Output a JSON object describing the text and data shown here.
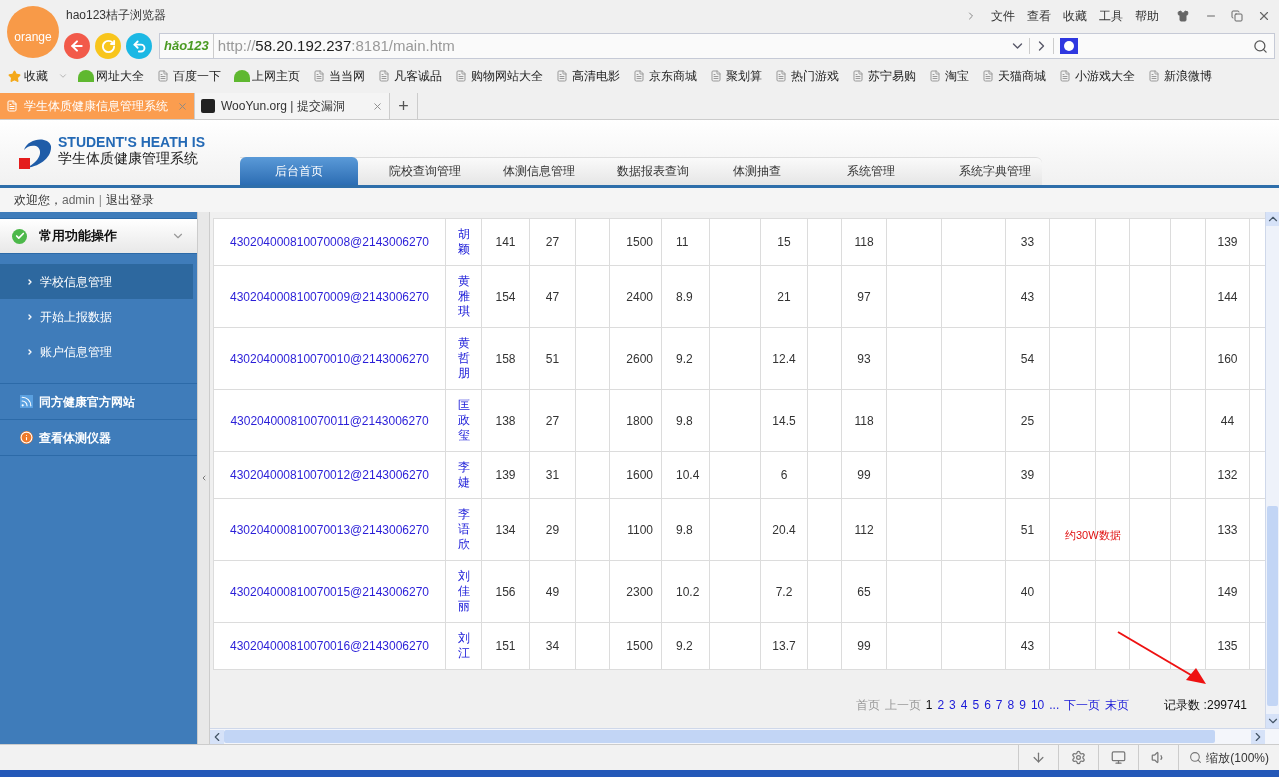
{
  "browser": {
    "logo": "orange",
    "title": "hao123桔子浏览器",
    "menu": [
      "文件",
      "查看",
      "收藏",
      "工具",
      "帮助"
    ],
    "address": {
      "badge": "hǎo123",
      "scheme": "http://",
      "host": "58.20.192.237",
      "rest": ":8181/main.htm"
    },
    "favorites_label": "收藏",
    "bookmarks": [
      {
        "label": "网址大全",
        "kind": "hao"
      },
      {
        "label": "百度一下",
        "kind": "page"
      },
      {
        "label": "上网主页",
        "kind": "hao"
      },
      {
        "label": "当当网",
        "kind": "page"
      },
      {
        "label": "凡客诚品",
        "kind": "page"
      },
      {
        "label": "购物网站大全",
        "kind": "page"
      },
      {
        "label": "高清电影",
        "kind": "page"
      },
      {
        "label": "京东商城",
        "kind": "page"
      },
      {
        "label": "聚划算",
        "kind": "page"
      },
      {
        "label": "热门游戏",
        "kind": "page"
      },
      {
        "label": "苏宁易购",
        "kind": "page"
      },
      {
        "label": "淘宝",
        "kind": "page"
      },
      {
        "label": "天猫商城",
        "kind": "page"
      },
      {
        "label": "小游戏大全",
        "kind": "page"
      },
      {
        "label": "新浪微博",
        "kind": "page"
      }
    ],
    "tabs": [
      {
        "label": "学生体质健康信息管理系统",
        "selected": true
      },
      {
        "label": "WooYun.org | 提交漏洞",
        "selected": false
      }
    ],
    "new_tab": "+"
  },
  "app": {
    "logo_en": "STUDENT'S HEATH IS",
    "logo_cn": "学生体质健康管理系统",
    "nav": [
      {
        "label": "后台首页",
        "selected": true
      },
      {
        "label": "院校查询管理",
        "selected": false
      },
      {
        "label": "体测信息管理",
        "selected": false
      },
      {
        "label": "数据报表查询",
        "selected": false
      },
      {
        "label": "体测抽查",
        "selected": false
      },
      {
        "label": "系统管理",
        "selected": false
      },
      {
        "label": "系统字典管理",
        "selected": false
      }
    ],
    "welcome": "欢迎您，",
    "user": "admin",
    "separator": "|",
    "logout": "退出登录"
  },
  "sidebar": {
    "group": {
      "label": "常用功能操作",
      "expanded": true,
      "items": [
        {
          "label": "学校信息管理",
          "selected": true
        },
        {
          "label": "开始上报数据",
          "selected": false
        },
        {
          "label": "账户信息管理",
          "selected": false
        }
      ]
    },
    "links": [
      {
        "label": "同方健康官方网站",
        "kind": "rss"
      },
      {
        "label": "查看体测仪器",
        "kind": "info"
      }
    ]
  },
  "table": {
    "rows": [
      {
        "id": "430204000810070008@2143006270",
        "name": "胡颖",
        "cells": {
          "column_3": "141",
          "column_4": "27",
          "column_6": "1500",
          "column_7": "11",
          "column_9": "15",
          "column_11": "118",
          "column_14": "33",
          "column_19": "139"
        }
      },
      {
        "id": "430204000810070009@2143006270",
        "name": "黄雅琪",
        "cells": {
          "column_3": "154",
          "column_4": "47",
          "column_6": "2400",
          "column_7": "8.9",
          "column_9": "21",
          "column_11": "97",
          "column_14": "43",
          "column_19": "144"
        }
      },
      {
        "id": "430204000810070010@2143006270",
        "name": "黄哲朋",
        "cells": {
          "column_3": "158",
          "column_4": "51",
          "column_6": "2600",
          "column_7": "9.2",
          "column_9": "12.4",
          "column_11": "93",
          "column_14": "54",
          "column_19": "160"
        }
      },
      {
        "id": "430204000810070011@2143006270",
        "name": "匡政玺",
        "cells": {
          "column_3": "138",
          "column_4": "27",
          "column_6": "1800",
          "column_7": "9.8",
          "column_9": "14.5",
          "column_11": "118",
          "column_14": "25",
          "column_19": "44"
        }
      },
      {
        "id": "430204000810070012@2143006270",
        "name": "李婕",
        "cells": {
          "column_3": "139",
          "column_4": "31",
          "column_6": "1600",
          "column_7": "10.4",
          "column_9": "6",
          "column_11": "99",
          "column_14": "39",
          "column_19": "132"
        }
      },
      {
        "id": "430204000810070013@2143006270",
        "name": "李语欣",
        "cells": {
          "column_3": "134",
          "column_4": "29",
          "column_6": "1100",
          "column_7": "9.8",
          "column_9": "20.4",
          "column_11": "112",
          "column_14": "51",
          "column_19": "133"
        }
      },
      {
        "id": "430204000810070015@2143006270",
        "name": "刘佳丽",
        "cells": {
          "column_3": "156",
          "column_4": "49",
          "column_6": "2300",
          "column_7": "10.2",
          "column_9": "7.2",
          "column_11": "65",
          "column_14": "40",
          "column_19": "149"
        }
      },
      {
        "id": "430204000810070016@2143006270",
        "name": "刘江",
        "cells": {
          "column_3": "151",
          "column_4": "34",
          "column_6": "1500",
          "column_7": "9.2",
          "column_9": "13.7",
          "column_11": "99",
          "column_14": "43",
          "column_19": "135"
        }
      }
    ],
    "annotation": "约30W数据"
  },
  "pagination": {
    "items": [
      {
        "label": "首页",
        "kind": "disabled"
      },
      {
        "label": "上一页",
        "kind": "disabled"
      },
      {
        "label": "1",
        "kind": "current"
      },
      {
        "label": "2",
        "kind": "link"
      },
      {
        "label": "3",
        "kind": "link"
      },
      {
        "label": "4",
        "kind": "link"
      },
      {
        "label": "5",
        "kind": "link"
      },
      {
        "label": "6",
        "kind": "link"
      },
      {
        "label": "7",
        "kind": "link"
      },
      {
        "label": "8",
        "kind": "link"
      },
      {
        "label": "9",
        "kind": "link"
      },
      {
        "label": "10",
        "kind": "link"
      },
      {
        "label": "...",
        "kind": "link"
      },
      {
        "label": "下一页",
        "kind": "link"
      },
      {
        "label": "末页",
        "kind": "link"
      }
    ],
    "record_label": "记录数 :",
    "record_count": "299741"
  },
  "status_bar": {
    "zoom": "缩放(100%)"
  }
}
